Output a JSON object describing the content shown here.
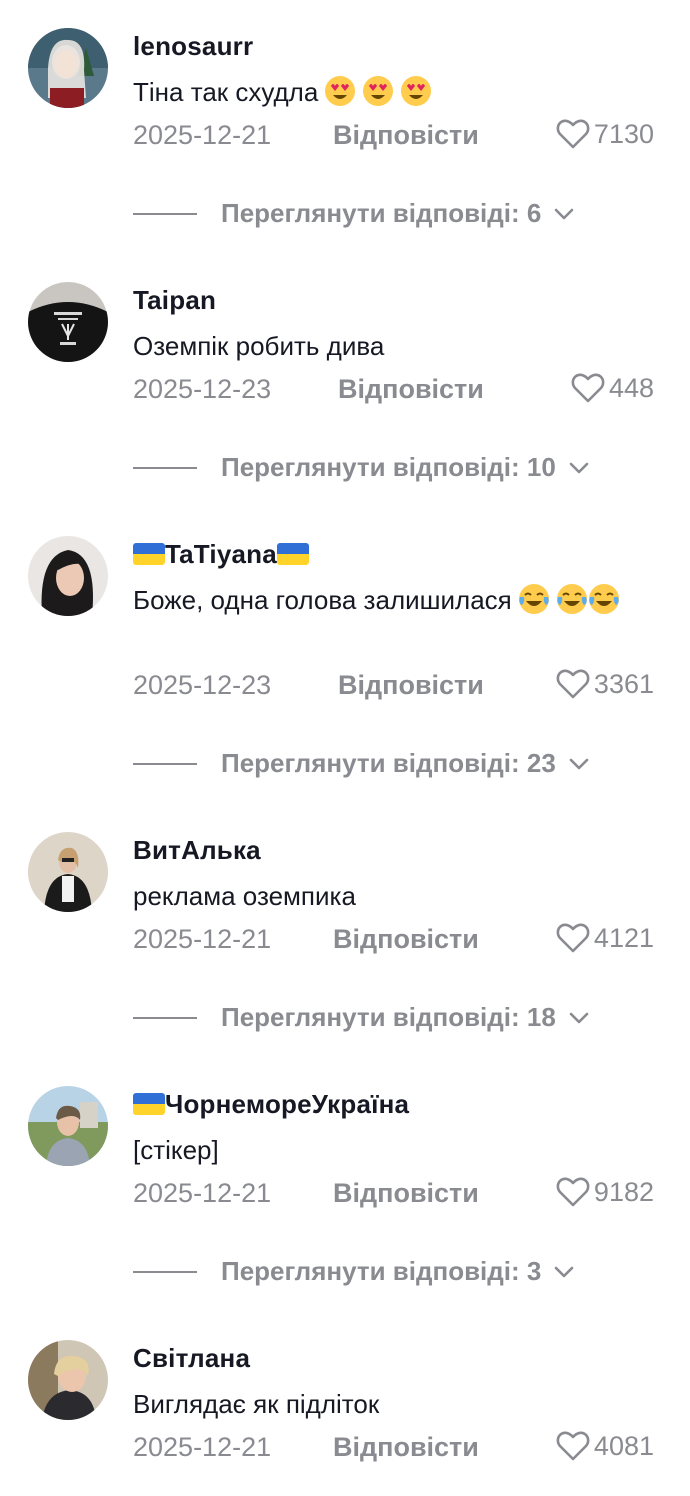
{
  "accent": "#8a8b91",
  "reply_label": "Відповісти",
  "view_prefix": "Переглянути відповіді:",
  "comments": [
    {
      "username": "lenosaurr",
      "text": "Тіна так схудла",
      "emojis": [
        "heart-eyes-emoji",
        "heart-eyes-emoji",
        "heart-eyes-emoji"
      ],
      "date": "2025-12-21",
      "likes": "7130",
      "view_replies": "Переглянути відповіді: 6",
      "flag": false
    },
    {
      "username": "Taipan",
      "text": "Оземпік робить дива",
      "emojis": [],
      "date": "2025-12-23",
      "likes": "448",
      "view_replies": "Переглянути відповіді: 10",
      "flag": false
    },
    {
      "username": "TaTiyana",
      "text": "Боже, одна голова залишилася",
      "emojis": [
        "tears-of-joy-emoji",
        "tears-of-joy-emoji",
        "tears-of-joy-emoji"
      ],
      "date": "2025-12-23",
      "likes": "3361",
      "view_replies": "Переглянути відповіді: 23",
      "flag": true
    },
    {
      "username": "ВитАлька",
      "text": "реклама оземпика",
      "emojis": [],
      "date": "2025-12-21",
      "likes": "4121",
      "view_replies": "Переглянути відповіді: 18",
      "flag": false
    },
    {
      "username": "ЧорнемореУкраїна",
      "text": "[стікер]",
      "emojis": [],
      "date": "2025-12-21",
      "likes": "9182",
      "view_replies": "Переглянути відповіді: 3",
      "flag": true
    },
    {
      "username": "Світлана",
      "text": "Виглядає як підліток",
      "emojis": [],
      "date": "2025-12-21",
      "likes": "4081",
      "view_replies": "",
      "flag": false
    }
  ]
}
